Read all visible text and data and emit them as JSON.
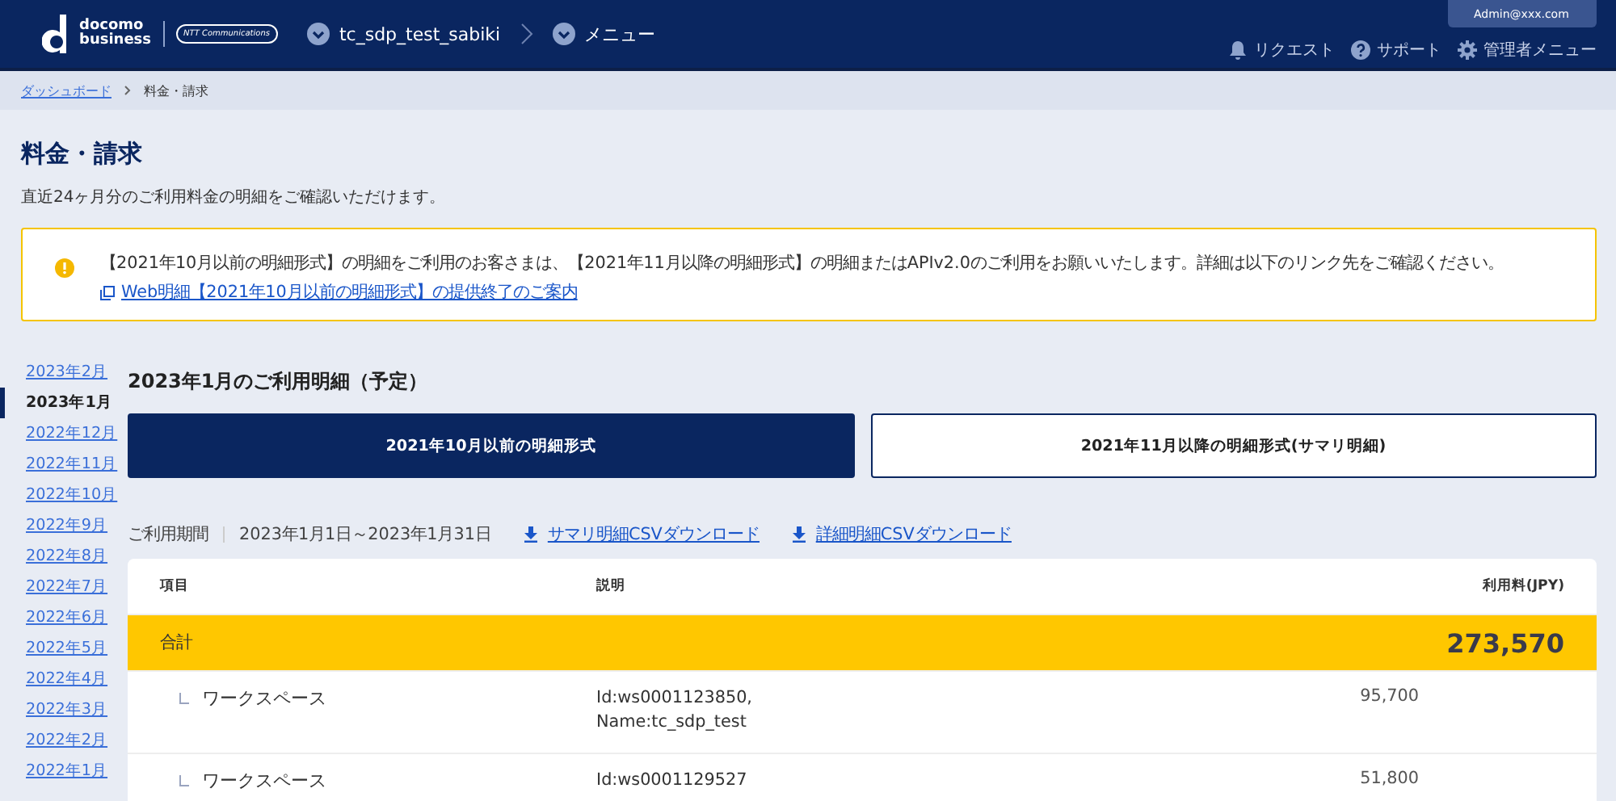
{
  "header": {
    "brand_top": "docomo",
    "brand_bottom": "business",
    "partner": "NTT Communications",
    "project": "tc_sdp_test_sabiki",
    "menu": "メニュー",
    "user": "Admin@xxx.com",
    "links": [
      {
        "kind": "bell",
        "label": "リクエスト"
      },
      {
        "kind": "help",
        "label": "サポート"
      },
      {
        "kind": "gear",
        "label": "管理者メニュー"
      }
    ]
  },
  "breadcrumb": [
    {
      "label": "ダッシュボード",
      "link": true
    },
    {
      "label": "料金・請求",
      "link": false
    }
  ],
  "page_title": "料金・請求",
  "description": "直近24ヶ月分のご利用料金の明細をご確認いただけます。",
  "notice": {
    "text": "【2021年10月以前の明細形式】の明細をご利用のお客さまは、【2021年11月以降の明細形式】の明細またはAPIv2.0のご利用をお願いいたします。詳細は以下のリンク先をご確認ください。",
    "link": "Web明細【2021年10月以前の明細形式】の提供終了のご案内"
  },
  "months": [
    {
      "label": "2023年2月",
      "selected": false
    },
    {
      "label": "2023年1月",
      "selected": true
    },
    {
      "label": "2022年12月",
      "selected": false
    },
    {
      "label": "2022年11月",
      "selected": false
    },
    {
      "label": "2022年10月",
      "selected": false
    },
    {
      "label": "2022年9月",
      "selected": false
    },
    {
      "label": "2022年8月",
      "selected": false
    },
    {
      "label": "2022年7月",
      "selected": false
    },
    {
      "label": "2022年6月",
      "selected": false
    },
    {
      "label": "2022年5月",
      "selected": false
    },
    {
      "label": "2022年4月",
      "selected": false
    },
    {
      "label": "2022年3月",
      "selected": false
    },
    {
      "label": "2022年2月",
      "selected": false
    },
    {
      "label": "2022年1月",
      "selected": false
    }
  ],
  "section_title": "2023年1月のご利用明細（予定）",
  "tabs": [
    {
      "label": "2021年10月以前の明細形式",
      "selected": true
    },
    {
      "label": "2021年11月以降の明細形式(サマリ明細)",
      "selected": false
    }
  ],
  "period": {
    "label": "ご利用期間",
    "value": "2023年1月1日～2023年1月31日"
  },
  "downloads": [
    "サマリ明細CSVダウンロード",
    "詳細明細CSVダウンロード"
  ],
  "table": {
    "columns": [
      "項目",
      "説明",
      "利用料(JPY)"
    ],
    "rows": [
      {
        "kind": "total",
        "item": "合計",
        "amount": "273,570"
      },
      {
        "kind": "child",
        "item": "ワークスペース",
        "description": [
          "Id:ws0001123850,",
          "Name:tc_sdp_test"
        ],
        "amount": "95,700"
      },
      {
        "kind": "child",
        "item": "ワークスペース",
        "description": [
          "Id:ws0001129527"
        ],
        "amount": "51,800"
      }
    ]
  }
}
